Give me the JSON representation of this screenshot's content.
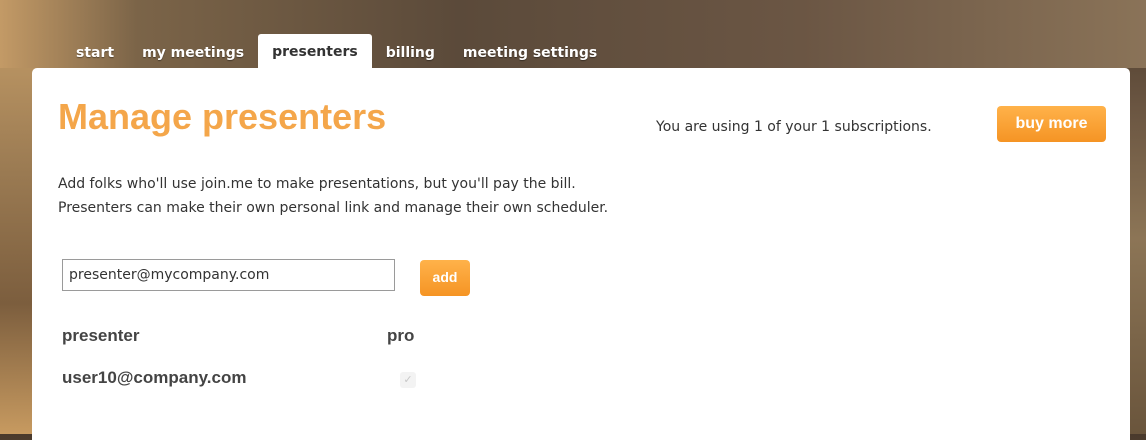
{
  "nav": {
    "tabs": [
      {
        "label": "start"
      },
      {
        "label": "my meetings"
      },
      {
        "label": "presenters",
        "active": true
      },
      {
        "label": "billing"
      },
      {
        "label": "meeting settings"
      }
    ]
  },
  "page": {
    "title": "Manage presenters",
    "subscription_note": "You are using 1 of your 1 subscriptions.",
    "buy_more_label": "buy more",
    "description_line1": "Add folks who'll use join.me to make presentations, but you'll pay the bill.",
    "description_line2": "Presenters can make their own personal link and manage their own scheduler."
  },
  "add_form": {
    "email_placeholder": "presenter@mycompany.com",
    "add_label": "add"
  },
  "table": {
    "headers": {
      "presenter": "presenter",
      "pro": "pro"
    },
    "rows": [
      {
        "email": "user10@company.com",
        "pro": true
      }
    ]
  },
  "colors": {
    "accent": "#f4a64a",
    "button": "#f59424"
  },
  "icons": {
    "pro_checkbox": "check-icon"
  }
}
